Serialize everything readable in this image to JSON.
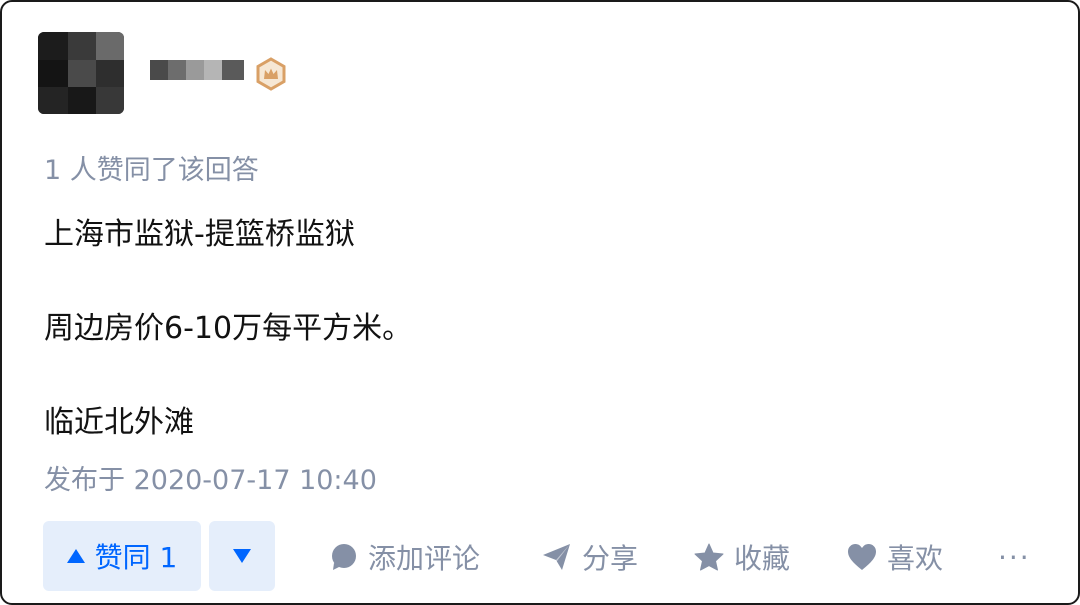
{
  "answer": {
    "likes_summary": "1 人赞同了该回答",
    "paragraphs": [
      "上海市监狱-提篮桥监狱",
      "周边房价6-10万每平方米。",
      "临近北外滩"
    ],
    "published": "发布于 2020-07-17 10:40"
  },
  "actions": {
    "upvote_label": "赞同 1",
    "comment_label": "添加评论",
    "share_label": "分享",
    "collect_label": "收藏",
    "like_label": "喜欢",
    "more_label": "···"
  },
  "icons": {
    "upvote": "triangle-up-icon",
    "downvote": "triangle-down-icon",
    "comment": "comment-bubble-icon",
    "share": "paper-plane-icon",
    "collect": "star-icon",
    "like": "heart-icon",
    "badge": "crown-badge-icon"
  },
  "colors": {
    "accent": "#0066ff",
    "button_bg": "#e5eefb",
    "meta_text": "#8590a6",
    "body_text": "#121212",
    "badge": "#d9a066"
  }
}
